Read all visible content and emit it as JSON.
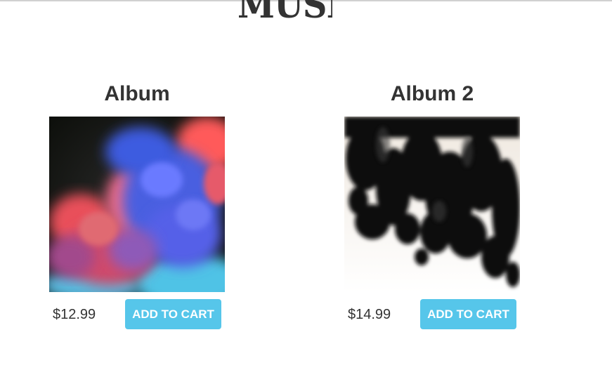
{
  "header": {
    "logo_text": "MUSIC"
  },
  "albums": [
    {
      "title": "Album",
      "price": "$12.99",
      "button_label": "ADD TO CART",
      "cover": "colorful-smoke-cover"
    },
    {
      "title": "Album 2",
      "price": "$14.99",
      "button_label": "ADD TO CART",
      "cover": "black-ink-cover"
    }
  ],
  "colors": {
    "button": "#56c6ea",
    "text": "#333333",
    "background": "#ffffff"
  }
}
